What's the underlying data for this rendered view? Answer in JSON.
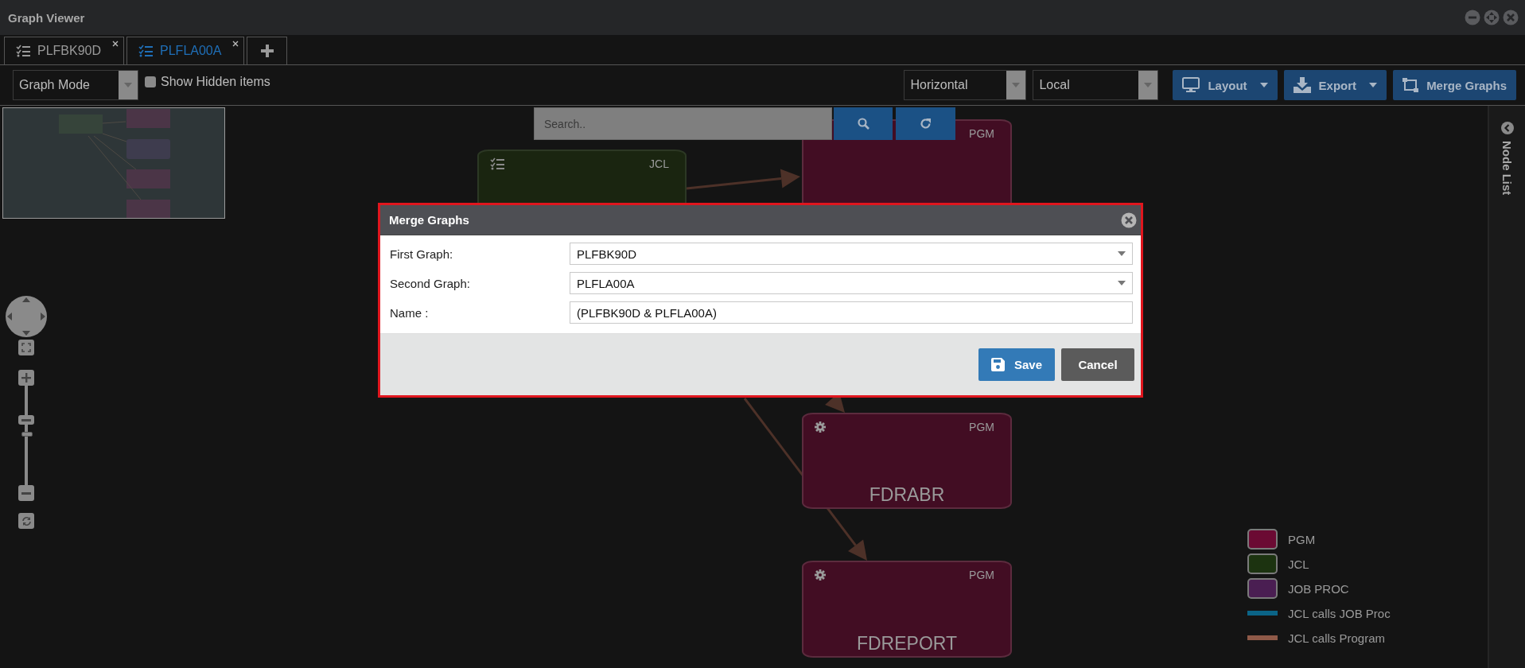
{
  "window": {
    "title": "Graph Viewer"
  },
  "tabs": [
    {
      "label": "PLFBK90D",
      "selected": false
    },
    {
      "label": "PLFLA00A",
      "selected": true
    }
  ],
  "toolbar": {
    "mode": "Graph Mode",
    "show_hidden": {
      "label": "Show Hidden items",
      "checked": false
    },
    "orientation": "Horizontal",
    "scope": "Local",
    "buttons": [
      {
        "label": "Layout",
        "kind": "dropdown"
      },
      {
        "label": "Export",
        "kind": "dropdown"
      },
      {
        "label": "Merge Graphs",
        "kind": "plain"
      }
    ]
  },
  "search": {
    "placeholder": "Search.."
  },
  "zoom_slider": {
    "level": 0.65
  },
  "nodes": [
    {
      "kind": "jcl",
      "type": "JCL"
    },
    {
      "kind": "pgm",
      "type": "PGM"
    },
    {
      "kind": "pgm",
      "type": "PGM",
      "name": "FDRABR"
    },
    {
      "kind": "pgm",
      "type": "PGM",
      "name": "FDREPORT"
    }
  ],
  "side_panel": {
    "title": "Node List"
  },
  "legend": [
    {
      "label": "PGM",
      "kind": "node",
      "color": "#6b0a33"
    },
    {
      "label": "JCL",
      "kind": "node",
      "color": "#1c3310"
    },
    {
      "label": "JOB PROC",
      "kind": "node",
      "color": "#4a1e52"
    },
    {
      "label": "JCL calls JOB Proc",
      "kind": "edge",
      "color": "#0b6487"
    },
    {
      "label": "JCL calls Program",
      "kind": "edge",
      "color": "#8f5a48"
    }
  ],
  "dialog": {
    "title": "Merge Graphs",
    "fields": [
      {
        "label": "First Graph:",
        "kind": "select",
        "value": "PLFBK90D"
      },
      {
        "label": "Second Graph:",
        "kind": "select",
        "value": "PLFLA00A"
      },
      {
        "label": "Name :",
        "kind": "text",
        "value": "(PLFBK90D & PLFLA00A)"
      }
    ],
    "buttons": [
      {
        "label": "Save",
        "kind": "primary"
      },
      {
        "label": "Cancel",
        "kind": "secondary"
      }
    ]
  }
}
